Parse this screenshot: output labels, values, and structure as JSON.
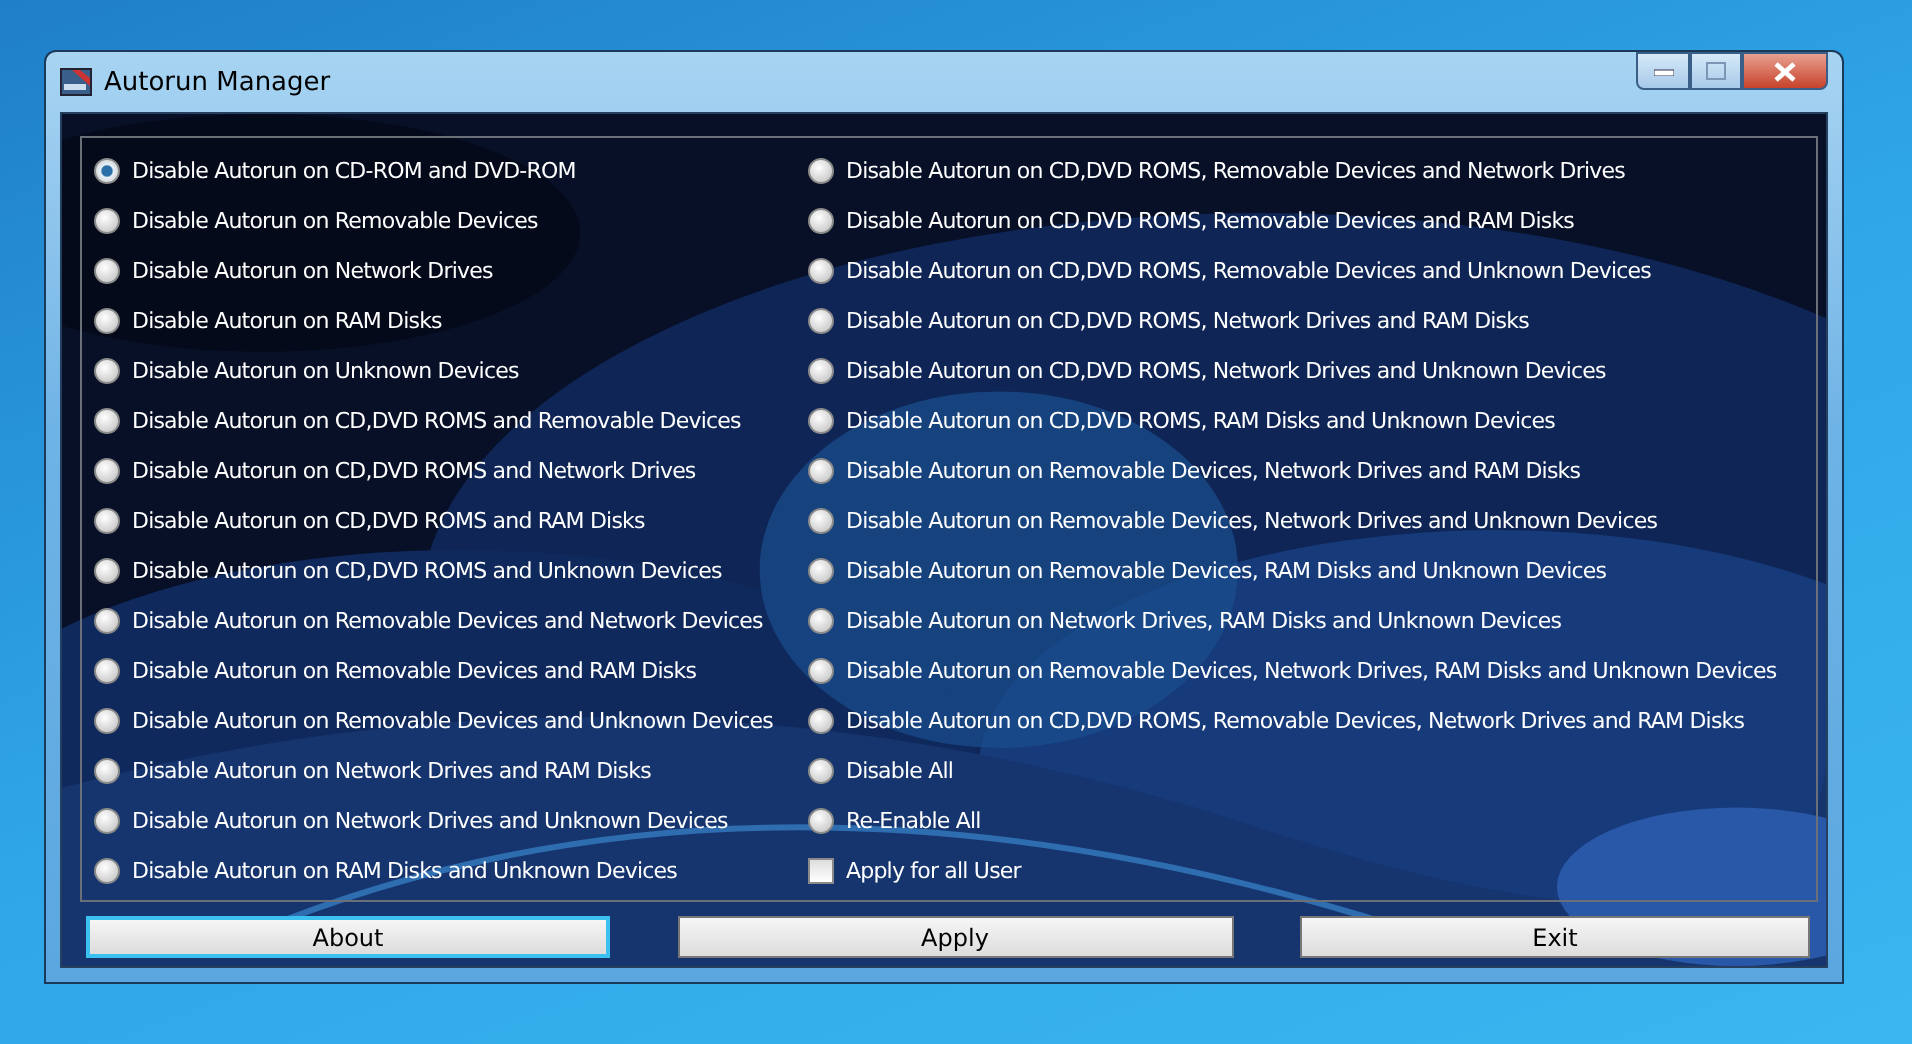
{
  "window": {
    "title": "Autorun Manager"
  },
  "columns": [
    [
      {
        "kind": "radio",
        "label": "Disable Autorun on CD-ROM and DVD-ROM",
        "selected": true
      },
      {
        "kind": "radio",
        "label": "Disable Autorun on Removable Devices",
        "selected": false
      },
      {
        "kind": "radio",
        "label": "Disable Autorun on Network Drives",
        "selected": false
      },
      {
        "kind": "radio",
        "label": "Disable Autorun on RAM Disks",
        "selected": false
      },
      {
        "kind": "radio",
        "label": "Disable Autorun on Unknown Devices",
        "selected": false
      },
      {
        "kind": "radio",
        "label": "Disable Autorun on CD,DVD ROMS and Removable Devices",
        "selected": false
      },
      {
        "kind": "radio",
        "label": "Disable Autorun on CD,DVD ROMS and Network Drives",
        "selected": false
      },
      {
        "kind": "radio",
        "label": "Disable Autorun on CD,DVD ROMS and RAM Disks",
        "selected": false
      },
      {
        "kind": "radio",
        "label": "Disable Autorun on CD,DVD ROMS and Unknown Devices",
        "selected": false
      },
      {
        "kind": "radio",
        "label": "Disable Autorun on Removable Devices and Network Devices",
        "selected": false
      },
      {
        "kind": "radio",
        "label": "Disable Autorun on Removable Devices and RAM Disks",
        "selected": false
      },
      {
        "kind": "radio",
        "label": "Disable Autorun on Removable Devices and Unknown Devices",
        "selected": false
      },
      {
        "kind": "radio",
        "label": "Disable Autorun on Network Drives and RAM Disks",
        "selected": false
      },
      {
        "kind": "radio",
        "label": "Disable Autorun on Network Drives and Unknown Devices",
        "selected": false
      },
      {
        "kind": "radio",
        "label": "Disable Autorun on RAM Disks and Unknown Devices",
        "selected": false
      }
    ],
    [
      {
        "kind": "radio",
        "label": "Disable Autorun on CD,DVD ROMS, Removable Devices and Network Drives",
        "selected": false
      },
      {
        "kind": "radio",
        "label": "Disable Autorun on CD,DVD ROMS, Removable Devices and RAM Disks",
        "selected": false
      },
      {
        "kind": "radio",
        "label": "Disable Autorun on CD,DVD ROMS, Removable Devices and Unknown Devices",
        "selected": false
      },
      {
        "kind": "radio",
        "label": "Disable Autorun on CD,DVD ROMS, Network Drives and RAM Disks",
        "selected": false
      },
      {
        "kind": "radio",
        "label": "Disable Autorun on CD,DVD ROMS, Network Drives and Unknown Devices",
        "selected": false
      },
      {
        "kind": "radio",
        "label": "Disable Autorun on CD,DVD ROMS, RAM Disks and Unknown Devices",
        "selected": false
      },
      {
        "kind": "radio",
        "label": "Disable Autorun on Removable Devices, Network Drives and RAM Disks",
        "selected": false
      },
      {
        "kind": "radio",
        "label": "Disable Autorun on Removable Devices, Network Drives and Unknown Devices",
        "selected": false
      },
      {
        "kind": "radio",
        "label": "Disable Autorun on Removable Devices, RAM Disks and Unknown Devices",
        "selected": false
      },
      {
        "kind": "radio",
        "label": "Disable Autorun on Network Drives, RAM Disks and Unknown Devices",
        "selected": false
      },
      {
        "kind": "radio",
        "label": "Disable Autorun on Removable Devices, Network Drives, RAM Disks and Unknown Devices",
        "selected": false
      },
      {
        "kind": "radio",
        "label": "Disable Autorun on CD,DVD ROMS, Removable Devices, Network Drives and RAM Disks",
        "selected": false
      },
      {
        "kind": "radio",
        "label": "Disable All",
        "selected": false
      },
      {
        "kind": "radio",
        "label": "Re-Enable All",
        "selected": false
      },
      {
        "kind": "checkbox",
        "label": "Apply for all User",
        "checked": false
      }
    ]
  ],
  "buttons": [
    {
      "label": "About",
      "focused": true
    },
    {
      "label": "Apply",
      "focused": false
    },
    {
      "label": "Exit",
      "focused": false
    }
  ]
}
